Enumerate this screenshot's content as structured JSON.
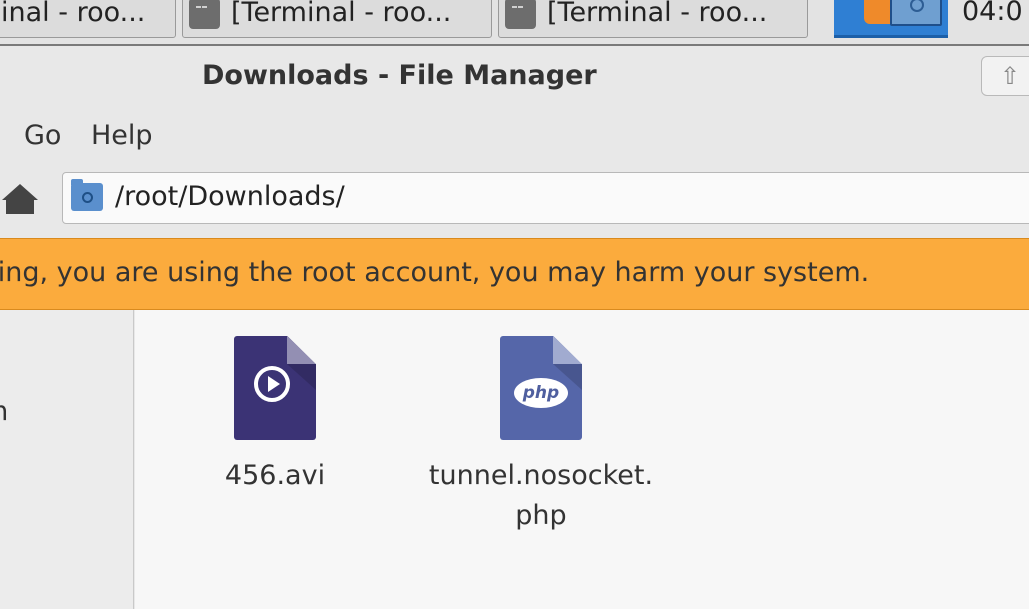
{
  "taskbar": {
    "tasks": [
      {
        "label": "inal - roo..."
      },
      {
        "label": "[Terminal - roo..."
      },
      {
        "label": "[Terminal - roo..."
      }
    ],
    "clock": "04:0"
  },
  "window": {
    "title": "Downloads - File Manager",
    "button_glyph": "⇧"
  },
  "menubar": {
    "items": [
      {
        "label": "Go"
      },
      {
        "label": "Help"
      }
    ]
  },
  "location": {
    "path": "/root/Downloads/"
  },
  "warning": {
    "text": "rning, you are using the root account, you may harm your system."
  },
  "sidebar": {
    "items": [
      {
        "label": "m"
      }
    ]
  },
  "files": [
    {
      "name": "456.avi",
      "type": "video",
      "icon": "video-file-icon",
      "color": "#3b3375"
    },
    {
      "name": "tunnel.nosocket.\nphp",
      "type": "php",
      "icon": "php-file-icon",
      "color": "#5566a9",
      "badge": "php"
    }
  ],
  "colors": {
    "warning": "#fbab3d",
    "accent": "#2f7fd3"
  }
}
